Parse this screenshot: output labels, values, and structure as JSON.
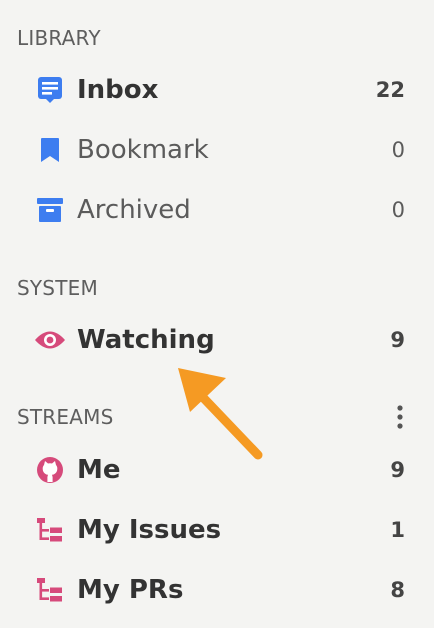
{
  "library": {
    "title": "LIBRARY",
    "items": [
      {
        "label": "Inbox",
        "count": "22",
        "icon": "inbox-icon"
      },
      {
        "label": "Bookmark",
        "count": "0",
        "icon": "bookmark-icon"
      },
      {
        "label": "Archived",
        "count": "0",
        "icon": "archive-icon"
      }
    ]
  },
  "system": {
    "title": "SYSTEM",
    "items": [
      {
        "label": "Watching",
        "count": "9",
        "icon": "eye-icon"
      }
    ]
  },
  "streams": {
    "title": "STREAMS",
    "menu_icon": "more-vertical-icon",
    "items": [
      {
        "label": "Me",
        "count": "9",
        "icon": "github-icon"
      },
      {
        "label": "My Issues",
        "count": "1",
        "icon": "tree-icon"
      },
      {
        "label": "My PRs",
        "count": "8",
        "icon": "tree-icon"
      }
    ]
  },
  "colors": {
    "blue": "#3d7df0",
    "pink": "#d64a7b",
    "orange": "#f59a23"
  }
}
